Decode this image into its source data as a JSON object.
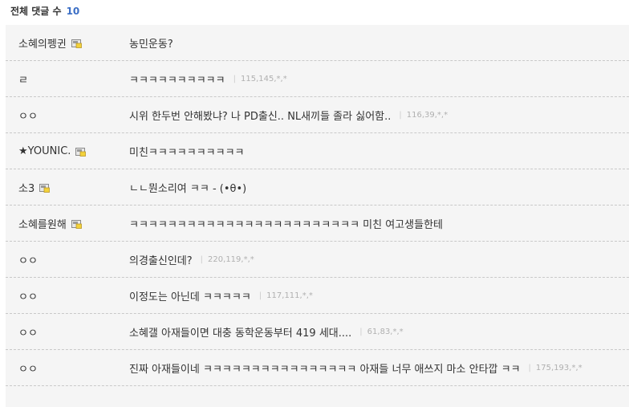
{
  "header": {
    "title": "전체 댓글 수",
    "count": "10"
  },
  "comments": [
    {
      "nick": "소혜의펭귄",
      "member_icon": true,
      "text": "농민운동?",
      "ip": ""
    },
    {
      "nick": "ㄹ",
      "member_icon": false,
      "text": "ㅋㅋㅋㅋㅋㅋㅋㅋㅋㅋ",
      "ip": "115,145,*,*"
    },
    {
      "nick": "ㅇㅇ",
      "member_icon": false,
      "text": "시위 한두번 안해봤냐? 나 PD출신.. NL새끼들 졸라 싫어함..",
      "ip": "116,39,*,*"
    },
    {
      "nick": "★YOUNIC.",
      "member_icon": true,
      "text": "미친ㅋㅋㅋㅋㅋㅋㅋㅋㅋㅋ",
      "ip": ""
    },
    {
      "nick": "소3",
      "member_icon": true,
      "text": "ㄴㄴ뭔소리여 ㅋㅋ - (•θ•)",
      "ip": ""
    },
    {
      "nick": "소혜를원해",
      "member_icon": true,
      "text": "ㅋㅋㅋㅋㅋㅋㅋㅋㅋㅋㅋㅋㅋㅋㅋㅋㅋㅋㅋㅋㅋㅋㅋㅋ 미친 여고생들한테",
      "ip": ""
    },
    {
      "nick": "ㅇㅇ",
      "member_icon": false,
      "text": "의경출신인데?",
      "ip": "220,119,*,*"
    },
    {
      "nick": "ㅇㅇ",
      "member_icon": false,
      "text": "이정도는 아닌데 ㅋㅋㅋㅋㅋ",
      "ip": "117,111,*,*"
    },
    {
      "nick": "ㅇㅇ",
      "member_icon": false,
      "text": "소혜갤 아재들이면 대충 동학운동부터 419 세대....",
      "ip": "61,83,*,*"
    },
    {
      "nick": "ㅇㅇ",
      "member_icon": false,
      "text": "진짜 아재들이네 ㅋㅋㅋㅋㅋㅋㅋㅋㅋㅋㅋㅋㅋㅋㅋㅋ 아재들 너무 애쓰지 마소 안타깝 ㅋㅋ",
      "ip": "175,193,*,*"
    }
  ]
}
